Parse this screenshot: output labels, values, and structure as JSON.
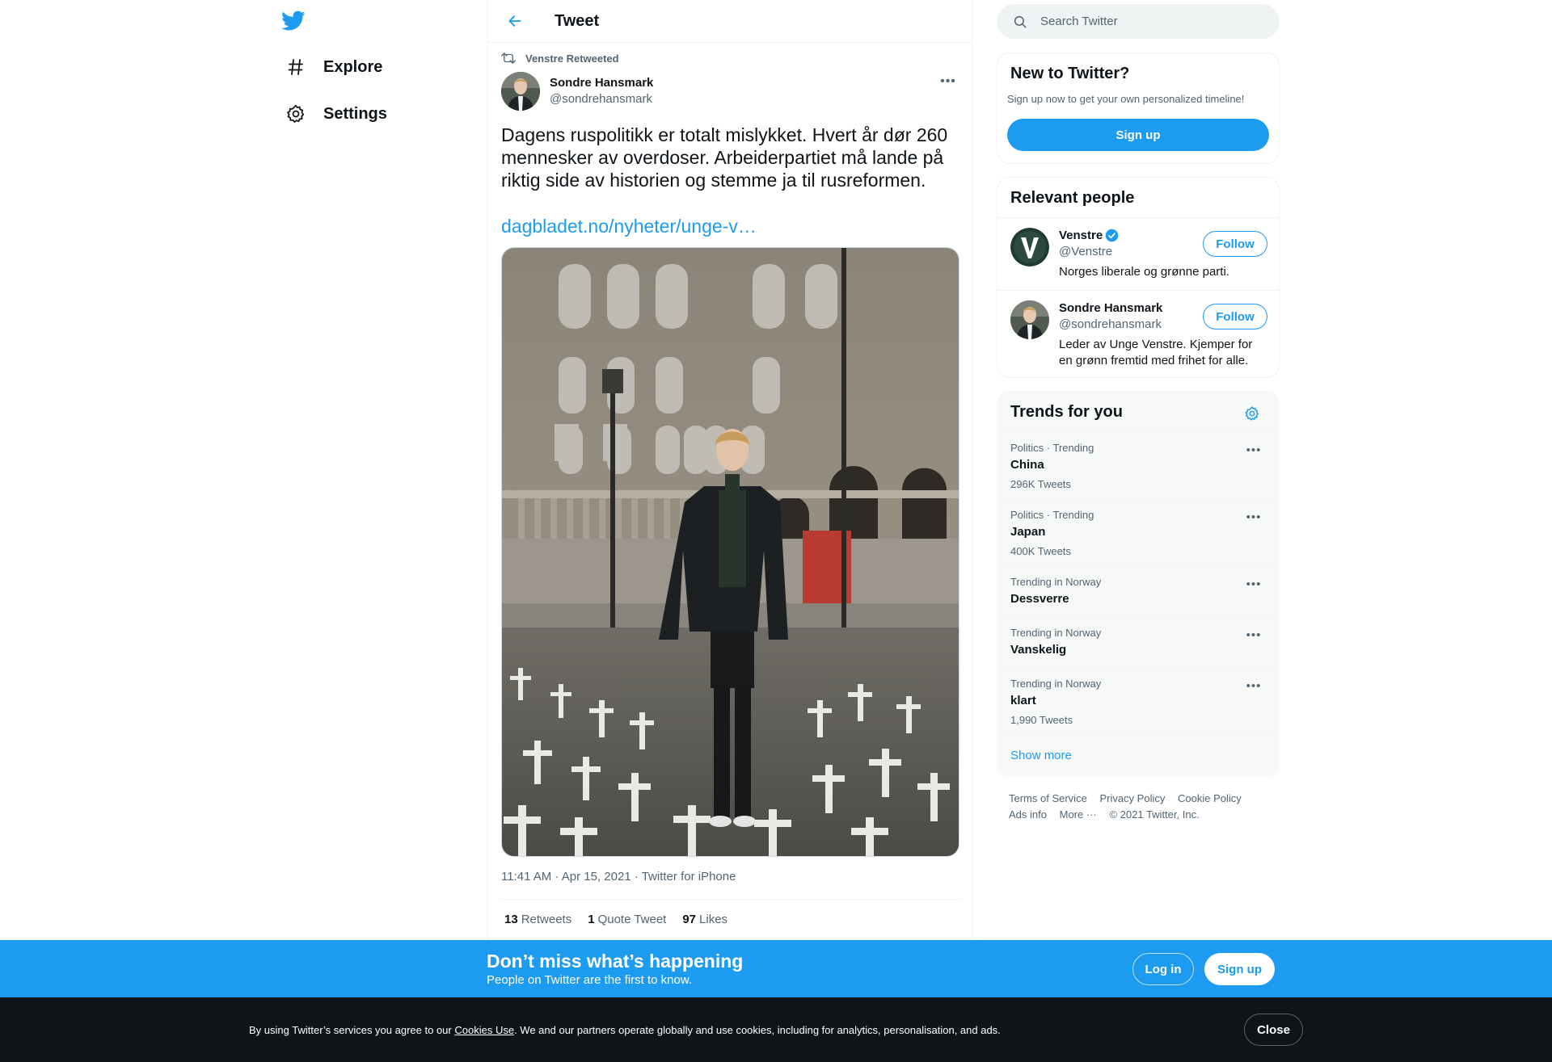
{
  "leftnav": {
    "logo_icon": "twitter-bird-icon",
    "items": [
      {
        "icon": "hashtag-icon",
        "label": "Explore"
      },
      {
        "icon": "gear-icon",
        "label": "Settings"
      }
    ]
  },
  "header": {
    "title": "Tweet",
    "back_icon": "arrow-left-icon"
  },
  "tweet": {
    "retweeted_by": "Venstre Retweeted",
    "author_name": "Sondre Hansmark",
    "author_handle": "@sondrehansmark",
    "text": "Dagens ruspolitikk er totalt mislykket. Hvert år dør 260 mennesker av overdoser. Arbeiderpartiet må lande på riktig side av historien og stemme ja til rusreformen.",
    "link": "dagbladet.no/nyheter/unge-v…",
    "meta": "11:41 AM · Apr 15, 2021 · Twitter for iPhone",
    "retweets_count": "13",
    "retweets_label": "Retweets",
    "quotes_count": "1",
    "quotes_label": "Quote Tweet",
    "likes_count": "97",
    "likes_label": "Likes"
  },
  "search": {
    "placeholder": "Search Twitter"
  },
  "new_to_twitter": {
    "title": "New to Twitter?",
    "subtitle": "Sign up now to get your own personalized timeline!",
    "signup_label": "Sign up"
  },
  "relevant_people": {
    "title": "Relevant people",
    "people": [
      {
        "name": "Venstre",
        "handle": "@Venstre",
        "bio": "Norges liberale og grønne parti.",
        "follow_label": "Follow",
        "verified": true
      },
      {
        "name": "Sondre Hansmark",
        "handle": "@sondrehansmark",
        "bio": "Leder av Unge Venstre. Kjemper for en grønn fremtid med frihet for alle.",
        "follow_label": "Follow",
        "verified": false
      }
    ]
  },
  "trends": {
    "title": "Trends for you",
    "items": [
      {
        "meta": "Politics · Trending",
        "name": "China",
        "count": "296K Tweets"
      },
      {
        "meta": "Politics · Trending",
        "name": "Japan",
        "count": "400K Tweets"
      },
      {
        "meta": "Trending in Norway",
        "name": "Dessverre",
        "count": ""
      },
      {
        "meta": "Trending in Norway",
        "name": "Vanskelig",
        "count": ""
      },
      {
        "meta": "Trending in Norway",
        "name": "klart",
        "count": "1,990 Tweets"
      }
    ],
    "show_more": "Show more"
  },
  "footer": {
    "links": [
      "Terms of Service",
      "Privacy Policy",
      "Cookie Policy",
      "Ads info",
      "More ···",
      "© 2021 Twitter, Inc."
    ]
  },
  "signup_banner": {
    "title": "Don’t miss what’s happening",
    "subtitle": "People on Twitter are the first to know.",
    "login_label": "Log in",
    "signup_label": "Sign up"
  },
  "cookie_banner": {
    "text_before": "By using Twitter’s services you agree to our ",
    "link_text": "Cookies Use",
    "text_after": ". We and our partners operate globally and use cookies, including for analytics, personalisation, and ads.",
    "close_label": "Close"
  },
  "colors": {
    "accent": "#1d9bf0",
    "text": "#0f1419",
    "secondary": "#536471",
    "banner_dark": "#0f1419"
  }
}
